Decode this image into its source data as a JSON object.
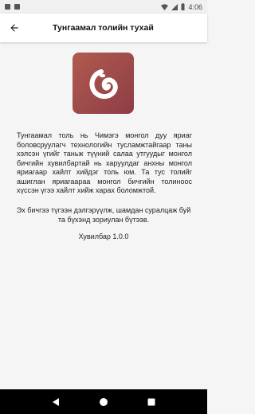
{
  "status_bar": {
    "time": "4:06"
  },
  "app_bar": {
    "title": "Тунгаамал толийн тухай"
  },
  "about": {
    "description": "Тунгаамал толь нь Чимэгэ монгол дуу яриаг боловсруулагч технологийн тусламжтайгаар таны хэлсэн үгийг таньж түүний салаа утгуудыг монгол бичгийн хувилбартай нь харуулдаг анхны монгол яриагаар хайлт хийдэг толь юм. Та тус толийг ашиглан яриагаараа монгол бичгийн толиноос хүссэн үгээ хайлт хийж харах боломжтой.",
    "feedback": "Эх бичгээ түгээн дэлгэрүүлж, шамдан суралцаж буй та бүхэнд зориулан бүтээв.",
    "version": "Хувилбар 1.0.0"
  },
  "colors": {
    "logo_start": "#b05a4e",
    "logo_end": "#8e3d46",
    "appbar_bg": "#ffffff",
    "page_bg": "#f5f5f5"
  },
  "icons": {
    "back": "arrow-left-icon",
    "logo": "app-logo-icon",
    "nav_back": "triangle-back-icon",
    "nav_home": "circle-home-icon",
    "nav_recents": "square-recents-icon"
  }
}
